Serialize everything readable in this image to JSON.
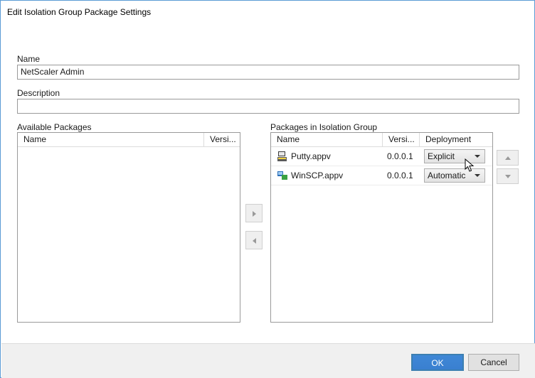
{
  "window": {
    "title": "Edit Isolation Group Package Settings"
  },
  "name_field": {
    "label": "Name",
    "value": "NetScaler Admin"
  },
  "description_field": {
    "label": "Description",
    "value": ""
  },
  "available": {
    "label": "Available Packages",
    "columns": [
      "Name",
      "Versi..."
    ]
  },
  "isolation": {
    "label": "Packages in Isolation Group",
    "columns": [
      "Name",
      "Versi...",
      "Deployment"
    ],
    "rows": [
      {
        "name": "Putty.appv",
        "version": "0.0.0.1",
        "deployment": "Explicit"
      },
      {
        "name": "WinSCP.appv",
        "version": "0.0.0.1",
        "deployment": "Automatic"
      }
    ]
  },
  "buttons": {
    "ok": "OK",
    "cancel": "Cancel"
  }
}
